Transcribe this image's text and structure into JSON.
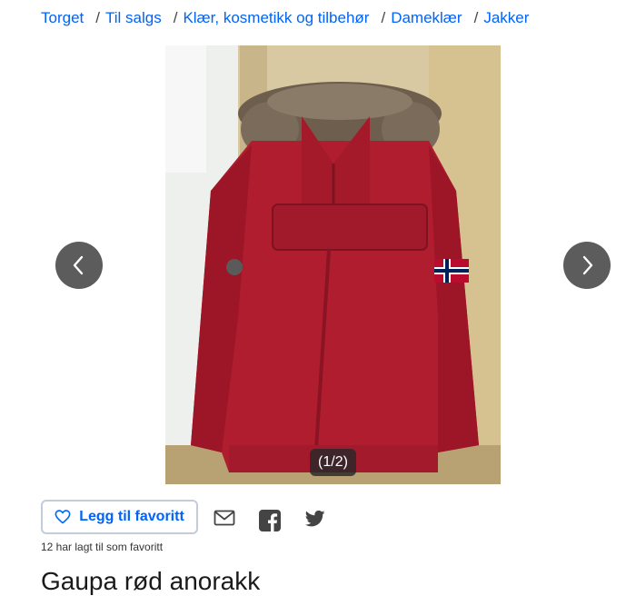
{
  "breadcrumb": {
    "items": [
      "Torget",
      "Til salgs",
      "Klær, kosmetikk og tilbehør",
      "Dameklær",
      "Jakker"
    ],
    "separator": "/"
  },
  "gallery": {
    "counter": "(1/2)",
    "image_subject": "red anorak with fur-trimmed hood on hanger"
  },
  "actions": {
    "favorite_label": "Legg til favoritt",
    "favorite_count_text": "12 har lagt til som favoritt",
    "share_icons": [
      "mail-icon",
      "facebook-icon",
      "twitter-icon"
    ]
  },
  "listing": {
    "title": "Gaupa rød anorakk"
  },
  "colors": {
    "link": "#0063fb",
    "nav_button": "#5c5c5c",
    "button_border": "#c3ccd9"
  }
}
